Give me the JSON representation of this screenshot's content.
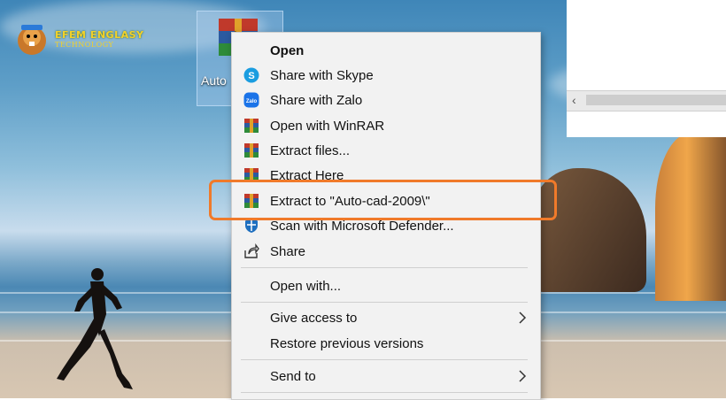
{
  "desktop": {
    "logo": {
      "line1": "EFEM ENGLASY",
      "line2": "TECHNOLOGY"
    },
    "icon": {
      "label": "Auto"
    }
  },
  "context_menu": {
    "items": [
      {
        "label": "Open",
        "icon": "open",
        "bold": true
      },
      {
        "label": "Share with Skype",
        "icon": "skype-icon"
      },
      {
        "label": "Share with Zalo",
        "icon": "zalo-icon"
      },
      {
        "label": "Open with WinRAR",
        "icon": "winrar-icon"
      },
      {
        "label": "Extract files...",
        "icon": "winrar-icon"
      },
      {
        "label": "Extract Here",
        "icon": "winrar-icon"
      },
      {
        "label": "Extract to \"Auto-cad-2009\\\"",
        "icon": "winrar-icon",
        "highlighted": true
      },
      {
        "label": "Scan with Microsoft Defender...",
        "icon": "defender-icon"
      },
      {
        "label": "Share",
        "icon": "share-icon"
      },
      {
        "label": "Open with...",
        "icon": ""
      },
      {
        "label": "Give access to",
        "icon": "",
        "submenu": true
      },
      {
        "label": "Restore previous versions",
        "icon": ""
      },
      {
        "label": "Send to",
        "icon": "",
        "submenu": true
      }
    ]
  },
  "colors": {
    "highlight": "#f07a2a",
    "menu_bg": "#f2f2f2",
    "skype": "#1a9de0",
    "zalo": "#1a73e8"
  }
}
